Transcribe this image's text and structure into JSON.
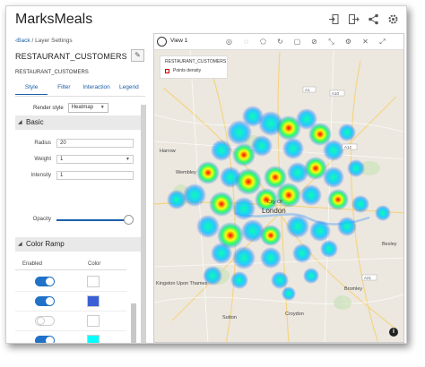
{
  "app": {
    "title": "MarksMeals"
  },
  "header_icons": [
    "sign-in-icon",
    "sign-out-icon",
    "share-icon",
    "gear-icon"
  ],
  "left_panel": {
    "back_label": "Back",
    "breadcrumb_sep": "/",
    "breadcrumb_current": "Layer Settings",
    "dataset_name": "RESTAURANT_CUSTOMERS",
    "dataset_subtitle": "RESTAURANT_CUSTOMERS",
    "tabs": [
      {
        "label": "Style",
        "active": true
      },
      {
        "label": "Filter",
        "active": false
      },
      {
        "label": "Interaction",
        "active": false
      },
      {
        "label": "Legend",
        "active": false
      }
    ],
    "render_style_label": "Render style",
    "render_style_value": "Heatmap",
    "basic": {
      "title": "Basic",
      "radius_label": "Radius",
      "radius_value": "20",
      "weight_label": "Weight",
      "weight_value": "1",
      "intensity_label": "Intensity",
      "intensity_value": "1",
      "opacity_label": "Opacity",
      "opacity_value": 1.0
    },
    "color_ramp": {
      "title": "Color Ramp",
      "enabled_header": "Enabled",
      "color_header": "Color",
      "rows": [
        {
          "enabled": true,
          "color": "#ffffff"
        },
        {
          "enabled": true,
          "color": "#3a5fd6"
        },
        {
          "enabled": false,
          "color": "#ffffff"
        },
        {
          "enabled": true,
          "color": "#00ffff"
        },
        {
          "enabled": false,
          "color": "#ffffff"
        }
      ]
    }
  },
  "map": {
    "view_title": "View 1",
    "tool_icons": [
      "target-icon",
      "lasso-icon",
      "polygon-icon",
      "rotate-icon",
      "rectangle-select-icon",
      "clear-selection-icon",
      "measure-icon",
      "settings-icon",
      "close-icon",
      "expand-icon"
    ],
    "legend": {
      "layer_name": "RESTAURANT_CUSTOMERS",
      "item_label": "Points density"
    },
    "places": [
      {
        "name": "Harrow",
        "key": "harrow"
      },
      {
        "name": "Wembley",
        "key": "wembley"
      },
      {
        "name": "City Of",
        "key": "city"
      },
      {
        "name": "London",
        "key": "london"
      },
      {
        "name": "Bexley",
        "key": "bexley"
      },
      {
        "name": "Bromley",
        "key": "bromley"
      },
      {
        "name": "Croydon",
        "key": "croydon"
      },
      {
        "name": "Kingston Upon Thames",
        "key": "kingston"
      },
      {
        "name": "Sutton",
        "key": "sutton"
      }
    ],
    "info_label": "i",
    "colors": {
      "accent": "#1f72c8",
      "heat_low": "#0040ff",
      "heat_mid": "#00ff80",
      "heat_high": "#ff0000"
    }
  }
}
